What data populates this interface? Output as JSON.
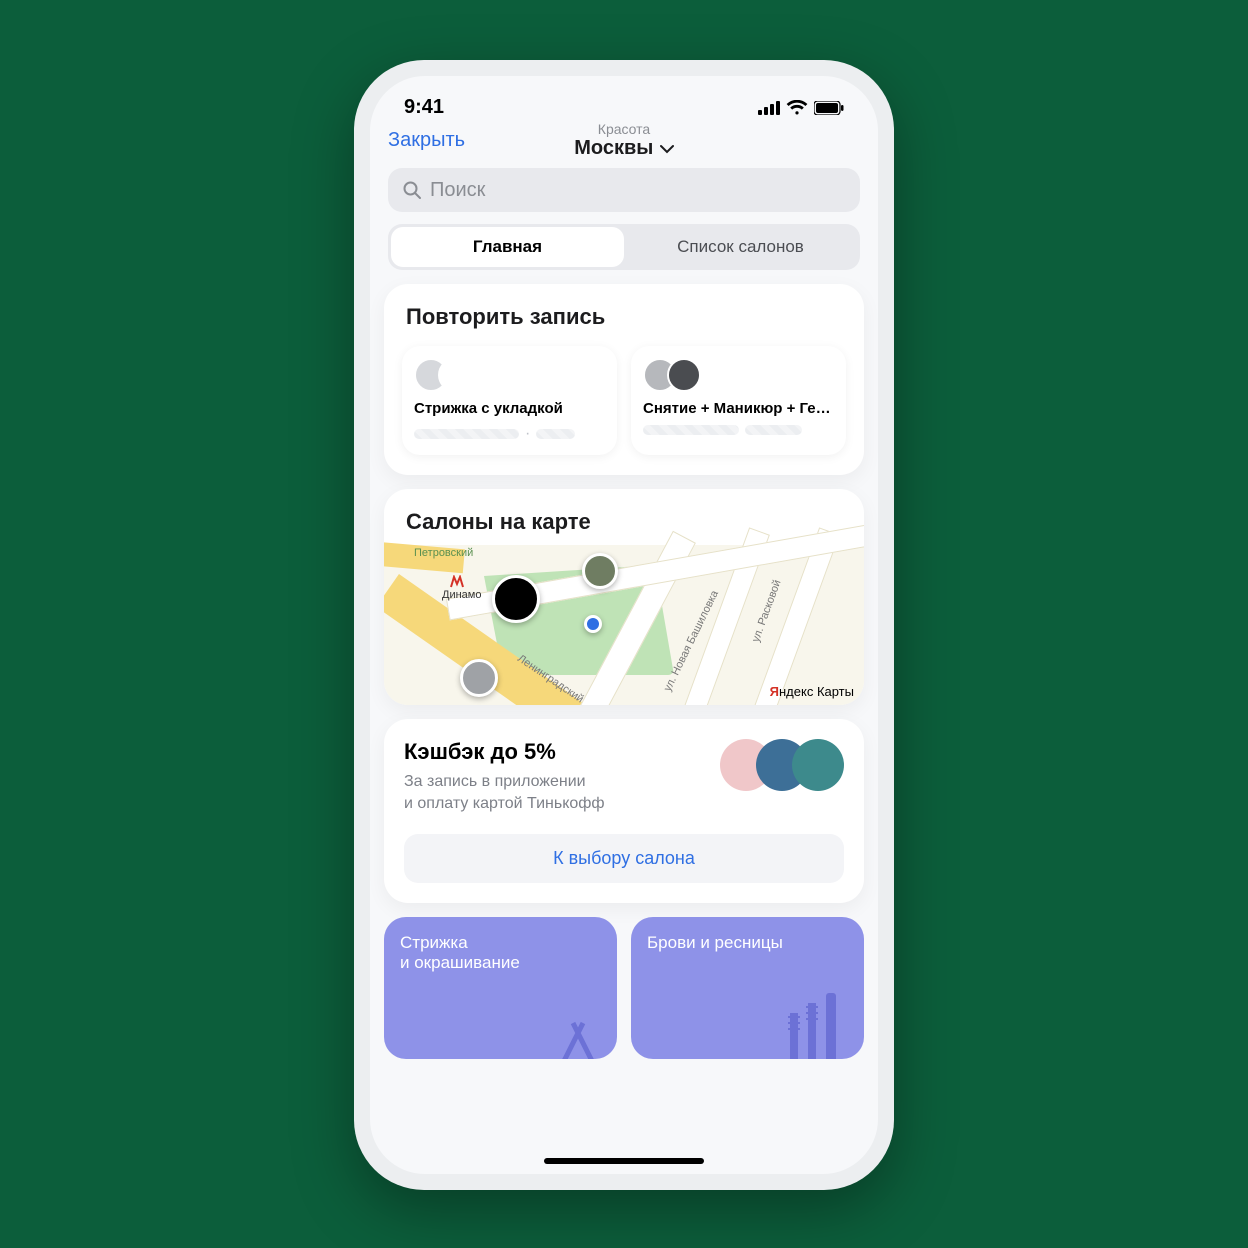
{
  "status": {
    "time": "9:41"
  },
  "nav": {
    "close": "Закрыть",
    "super": "Красота",
    "city": "Москвы"
  },
  "search": {
    "placeholder": "Поиск"
  },
  "tabs": {
    "main": "Главная",
    "list": "Список салонов"
  },
  "repeat": {
    "title": "Повторить запись",
    "items": [
      {
        "name": "Стрижка с укладкой"
      },
      {
        "name": "Снятие + Маникюр + Гель"
      }
    ]
  },
  "map": {
    "title": "Салоны на карте",
    "brand_y": "Я",
    "brand_rest": "ндекс Карты",
    "labels": {
      "petrovsky": "Петровский",
      "dinamo": "Динамо",
      "bashilovka": "ул. Новая Башиловка",
      "raskovoy": "ул. Расковой",
      "leningrad": "Ленинградский"
    }
  },
  "cashback": {
    "title": "Кэшбэк до 5%",
    "sub1": "За запись в приложении",
    "sub2": "и оплату картой Тинькофф",
    "button": "К выбору салона"
  },
  "categories": {
    "a1": "Стрижка",
    "a2": "и окрашивание",
    "b": "Брови и ресницы"
  }
}
